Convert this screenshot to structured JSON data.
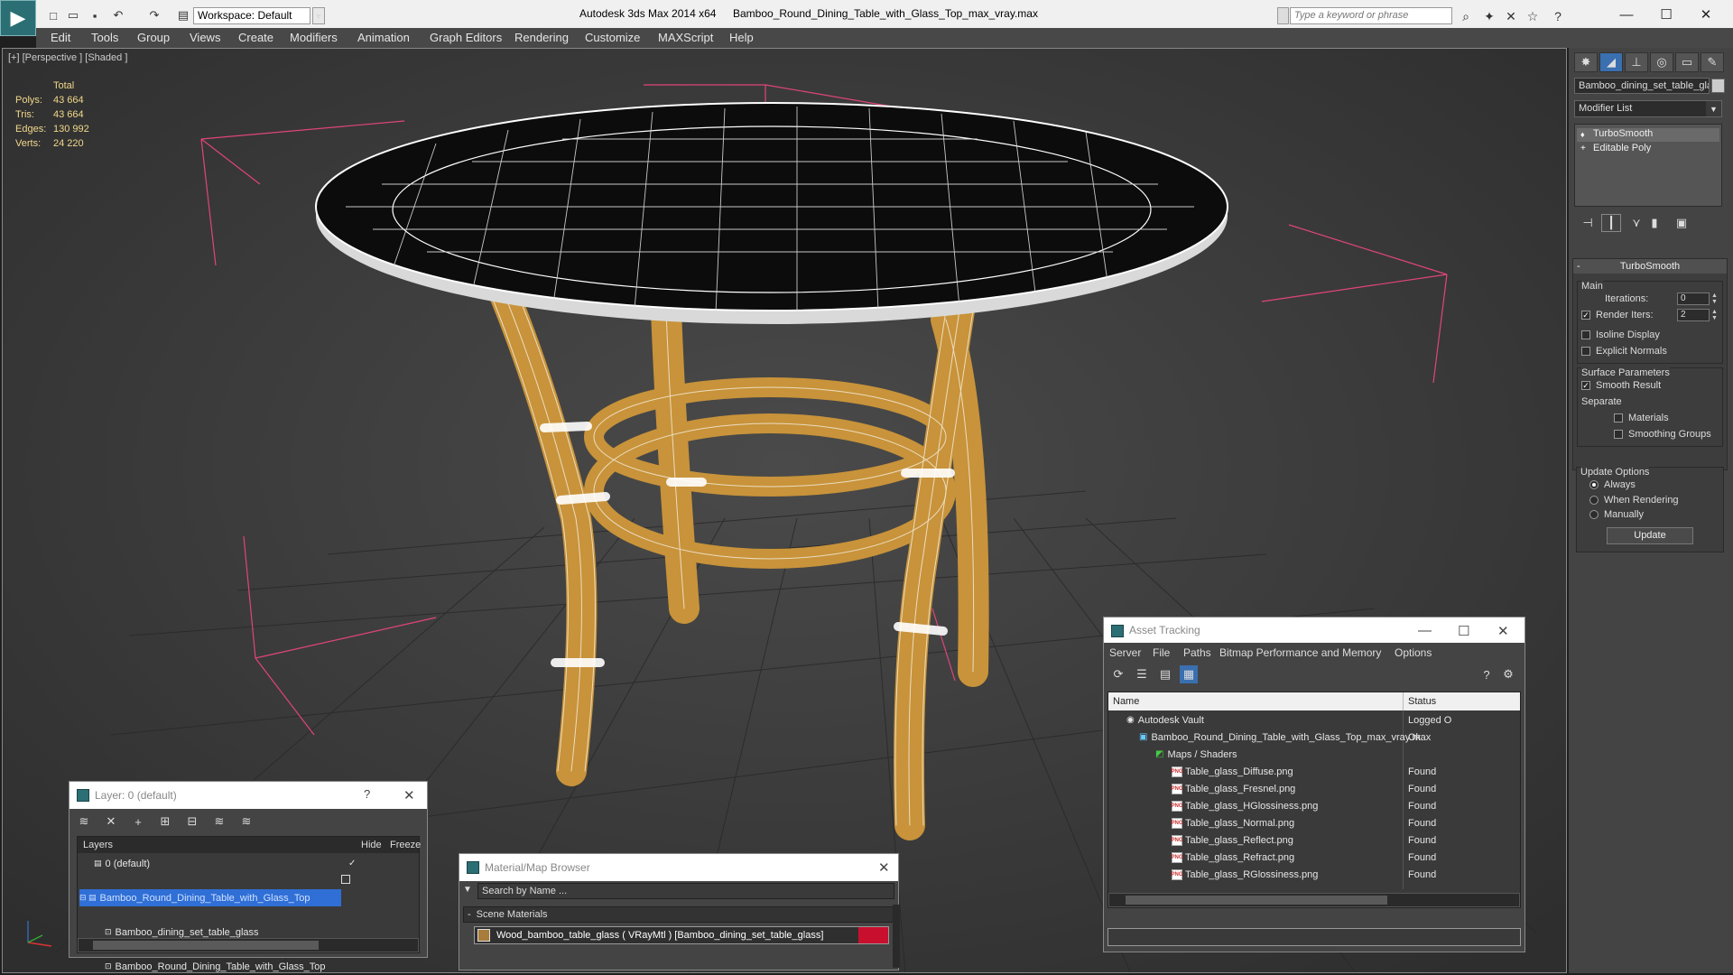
{
  "titlebar": {
    "app_title": "Autodesk 3ds Max  2014 x64",
    "doc_title": "Bamboo_Round_Dining_Table_with_Glass_Top_max_vray.max",
    "workspace": "Workspace: Default",
    "search_placeholder": "Type a keyword or phrase",
    "app_icon": "3ds-max-logo-icon"
  },
  "menu": [
    "Edit",
    "Tools",
    "Group",
    "Views",
    "Create",
    "Modifiers",
    "Animation",
    "Graph Editors",
    "Rendering",
    "Customize",
    "MAXScript",
    "Help"
  ],
  "viewport": {
    "label": "[+] [Perspective ] [Shaded ]",
    "stats": {
      "header": "Total",
      "rows": [
        {
          "label": "Polys:",
          "value": "43 664"
        },
        {
          "label": "Tris:",
          "value": "43 664"
        },
        {
          "label": "Edges:",
          "value": "130 992"
        },
        {
          "label": "Verts:",
          "value": "24 220"
        }
      ]
    }
  },
  "command_panel": {
    "object_name": "Bamboo_dining_set_table_gla",
    "modifier_list": "Modifier List",
    "stack": [
      "TurboSmooth",
      "Editable Poly"
    ],
    "rollout_title": "TurboSmooth",
    "main_label": "Main",
    "iterations_label": "Iterations:",
    "iterations_value": "0",
    "render_iters_label": "Render Iters:",
    "render_iters_value": "2",
    "isoline_display": "Isoline Display",
    "explicit_normals": "Explicit Normals",
    "surface_params_label": "Surface Parameters",
    "smooth_result": "Smooth Result",
    "separate_label": "Separate",
    "materials": "Materials",
    "smoothing_groups": "Smoothing Groups",
    "update_options_label": "Update Options",
    "always": "Always",
    "when_rendering": "When Rendering",
    "manually": "Manually",
    "update_button": "Update"
  },
  "layer_dialog": {
    "title": "Layer: 0 (default)",
    "help": "?",
    "col_layers": "Layers",
    "col_hide": "Hide",
    "col_freeze": "Freeze",
    "rows": [
      {
        "name": "0 (default)"
      },
      {
        "name": "Bamboo_Round_Dining_Table_with_Glass_Top"
      },
      {
        "name": "Bamboo_dining_set_table_glass"
      },
      {
        "name": "Bamboo_Round_Dining_Table_with_Glass_Top"
      }
    ]
  },
  "material_browser": {
    "title": "Material/Map Browser",
    "search_placeholder": "Search by Name ...",
    "section": "Scene Materials",
    "material": "Wood_bamboo_table_glass  ( VRayMtl ) [Bamboo_dining_set_table_glass]"
  },
  "asset_tracking": {
    "title": "Asset Tracking",
    "menu": [
      "Server",
      "File",
      "Paths",
      "Bitmap Performance and Memory",
      "Options"
    ],
    "col_name": "Name",
    "col_status": "Status",
    "rows": [
      {
        "name": "Autodesk Vault",
        "status": "Logged O",
        "indent": 0,
        "icon": "vault-icon"
      },
      {
        "name": "Bamboo_Round_Dining_Table_with_Glass_Top_max_vray.max",
        "status": "Ok",
        "indent": 1,
        "icon": "max-file-icon"
      },
      {
        "name": "Maps / Shaders",
        "status": "",
        "indent": 2,
        "icon": "maps-icon"
      },
      {
        "name": "Table_glass_Diffuse.png",
        "status": "Found",
        "indent": 3,
        "icon": "png-icon"
      },
      {
        "name": "Table_glass_Fresnel.png",
        "status": "Found",
        "indent": 3,
        "icon": "png-icon"
      },
      {
        "name": "Table_glass_HGlossiness.png",
        "status": "Found",
        "indent": 3,
        "icon": "png-icon"
      },
      {
        "name": "Table_glass_Normal.png",
        "status": "Found",
        "indent": 3,
        "icon": "png-icon"
      },
      {
        "name": "Table_glass_Reflect.png",
        "status": "Found",
        "indent": 3,
        "icon": "png-icon"
      },
      {
        "name": "Table_glass_Refract.png",
        "status": "Found",
        "indent": 3,
        "icon": "png-icon"
      },
      {
        "name": "Table_glass_RGlossiness.png",
        "status": "Found",
        "indent": 3,
        "icon": "png-icon"
      }
    ]
  },
  "colors": {
    "viewport_bg": "#3d3d3d",
    "bamboo": "#c8933a",
    "selection": "#2f6fd6",
    "stats_text": "#f2d98b",
    "bbox": "#e0457a"
  }
}
